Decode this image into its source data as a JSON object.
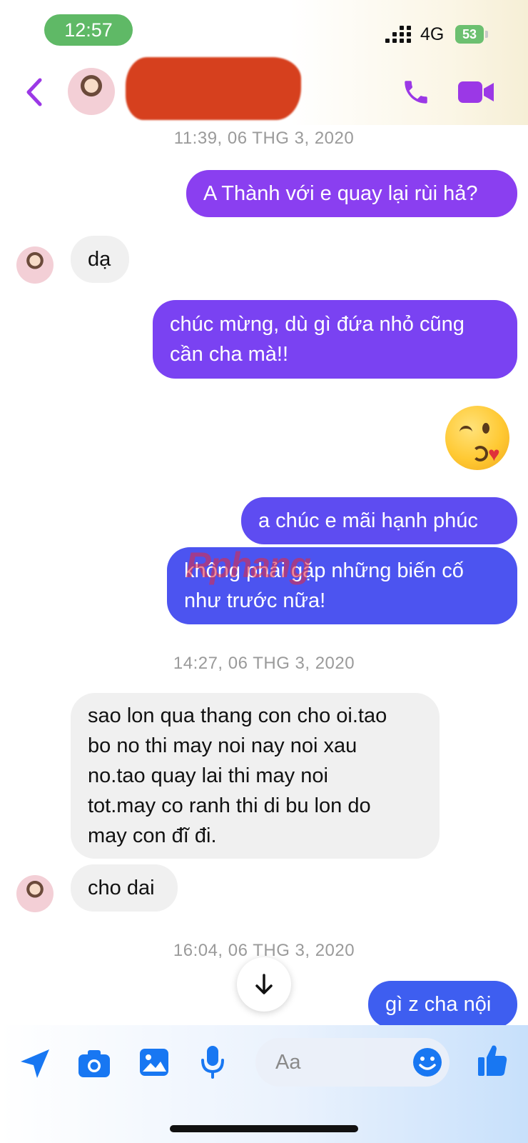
{
  "status_bar": {
    "time": "12:57",
    "network": "4G",
    "battery": "53"
  },
  "header": {
    "back_icon": "chevron-left-icon",
    "call_icon": "phone-icon",
    "video_icon": "video-camera-icon",
    "accent_color": "#9b38e6"
  },
  "watermark": "Rphang",
  "messages": [
    {
      "type": "timestamp",
      "text": "11:39, 06 THG 3, 2020"
    },
    {
      "type": "outgoing",
      "text": "A Thành với e quay lại rùi hả?"
    },
    {
      "type": "incoming",
      "text": "dạ"
    },
    {
      "type": "outgoing",
      "lines": [
        "chúc mừng, dù gì đứa nhỏ cũng",
        "cần cha mà!!"
      ]
    },
    {
      "type": "emoji",
      "icon": "kissing-face-with-heart-emoji"
    },
    {
      "type": "outgoing",
      "text": "a chúc e mãi hạnh phúc"
    },
    {
      "type": "outgoing",
      "lines": [
        "không phải gặp những biến cố",
        "như trước nữa!"
      ]
    },
    {
      "type": "timestamp",
      "text": "14:27, 06 THG 3, 2020"
    },
    {
      "type": "incoming",
      "lines": [
        "sao lon qua thang con cho oi.tao",
        "bo no thi may noi nay noi xau",
        "no.tao quay lai thi may noi",
        "tot.may co ranh thi di bu lon do",
        "may con đĩ đi."
      ]
    },
    {
      "type": "incoming",
      "text": "cho dai"
    },
    {
      "type": "timestamp",
      "text": "16:04, 06 THG 3, 2020"
    },
    {
      "type": "outgoing",
      "text": "gì z cha nội"
    }
  ],
  "composer": {
    "placeholder": "Aa",
    "icons": [
      "send-location-icon",
      "camera-icon",
      "gallery-icon",
      "microphone-icon",
      "emoji-icon",
      "thumbs-up-icon"
    ]
  },
  "colors": {
    "outgoing_top": "#8a3ff0",
    "outgoing_bottom": "#3e5ef0",
    "incoming": "#f0f0f0",
    "timestamp": "#9a9a9a"
  }
}
